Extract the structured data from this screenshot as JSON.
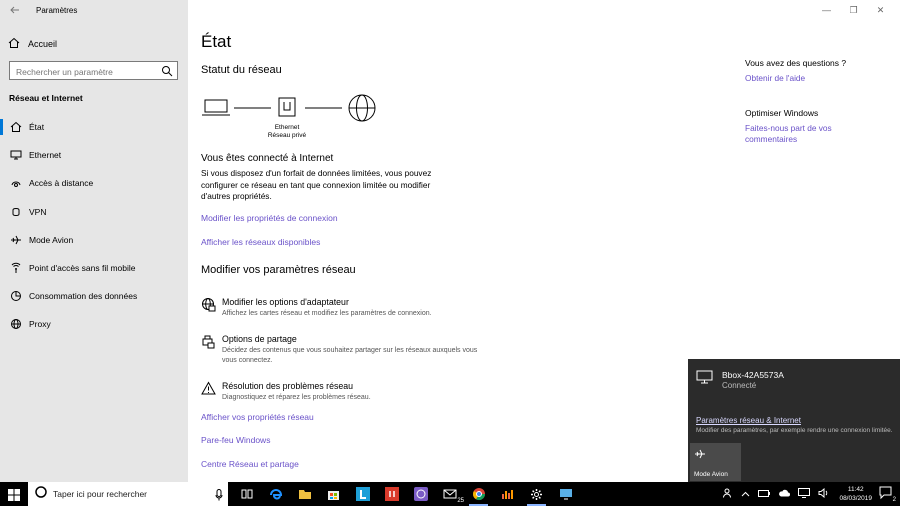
{
  "window": {
    "title": "Paramètres",
    "controls": [
      "—",
      "❐",
      "✕"
    ]
  },
  "sidebar": {
    "home_label": "Accueil",
    "search_placeholder": "Rechercher un paramètre",
    "section_title": "Réseau et Internet",
    "items": [
      {
        "label": "État",
        "icon": "home-state-icon",
        "active": true
      },
      {
        "label": "Ethernet",
        "icon": "ethernet-icon"
      },
      {
        "label": "Accès à distance",
        "icon": "dialup-icon"
      },
      {
        "label": "VPN",
        "icon": "vpn-icon"
      },
      {
        "label": "Mode Avion",
        "icon": "airplane-icon"
      },
      {
        "label": "Point d'accès sans fil mobile",
        "icon": "hotspot-icon"
      },
      {
        "label": "Consommation des données",
        "icon": "data-usage-icon"
      },
      {
        "label": "Proxy",
        "icon": "globe-icon"
      }
    ]
  },
  "main": {
    "title": "État",
    "network_status_heading": "Statut du réseau",
    "diagram": {
      "adapter_label": "Ethernet",
      "network_label": "Réseau privé"
    },
    "connected_heading": "Vous êtes connecté à Internet",
    "connected_text": "Si vous disposez d'un forfait de données limitées, vous pouvez configurer ce réseau en tant que connexion limitée ou modifier d'autres propriétés.",
    "link_change_props": "Modifier les propriétés de connexion",
    "link_show_networks": "Afficher les réseaux disponibles",
    "modify_heading": "Modifier vos paramètres réseau",
    "options": [
      {
        "title": "Modifier les options d'adaptateur",
        "desc": "Affichez les cartes réseau et modifiez les paramètres de connexion."
      },
      {
        "title": "Options de partage",
        "desc": "Décidez des contenus que vous souhaitez partager sur les réseaux auxquels vous vous connectez."
      },
      {
        "title": "Résolution des problèmes réseau",
        "desc": "Diagnostiquez et réparez les problèmes réseau."
      }
    ],
    "link_view_props": "Afficher vos propriétés réseau",
    "link_firewall": "Pare-feu Windows",
    "link_network_center": "Centre Réseau et partage"
  },
  "right_column": {
    "questions_heading": "Vous avez des questions ?",
    "help_link": "Obtenir de l'aide",
    "improve_heading": "Optimiser Windows",
    "feedback_link": "Faites-nous part de vos commentaires"
  },
  "flyout": {
    "network_name": "Bbox-42A5573A",
    "network_status": "Connecté",
    "settings_link": "Paramètres réseau & Internet",
    "settings_desc": "Modifier des paramètres, par exemple rendre une connexion limitée.",
    "tile_label": "Mode Avion"
  },
  "taskbar": {
    "search_placeholder": "Taper ici pour rechercher",
    "time": "11:42",
    "date": "08/03/2019",
    "notification_count": "2",
    "badge_count": "25"
  },
  "colors": {
    "accent": "#0078d7",
    "link": "#6a52c9",
    "sidebar_bg": "#e6e6e6",
    "flyout_bg": "#2b2b2b"
  }
}
